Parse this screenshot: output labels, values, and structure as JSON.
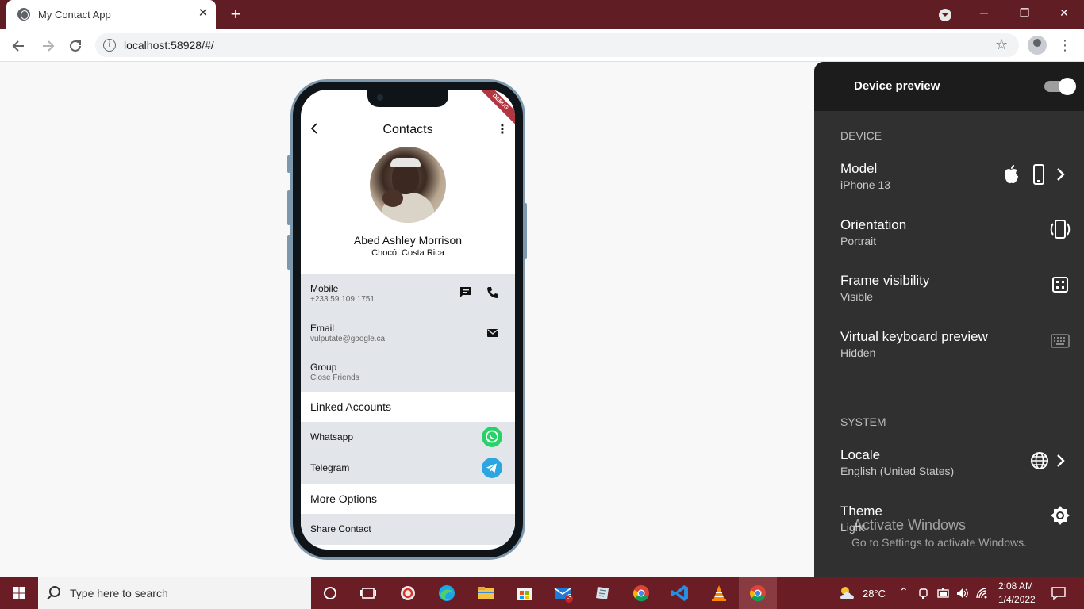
{
  "browser": {
    "tab_title": "My Contact App",
    "tab_close": "✕",
    "new_tab": "+",
    "url": "localhost:58928/#/",
    "window_controls": {
      "minimize": "─",
      "restore": "❐",
      "close": "✕"
    }
  },
  "app": {
    "title": "Contacts",
    "debug_banner": "DEBUG",
    "contact": {
      "name": "Abed Ashley Morrison",
      "location": "Chocó, Costa Rica"
    },
    "info": [
      {
        "label": "Mobile",
        "value": "+233 59 109 1751"
      },
      {
        "label": "Email",
        "value": "vulputate@google.ca"
      },
      {
        "label": "Group",
        "value": "Close Friends"
      }
    ],
    "linked_accounts": {
      "heading": "Linked Accounts",
      "items": [
        {
          "label": "Whatsapp",
          "color": "#25d366"
        },
        {
          "label": "Telegram",
          "color": "#2aa6e0"
        }
      ]
    },
    "more_options": {
      "heading": "More Options",
      "items": [
        "Share Contact"
      ]
    }
  },
  "device_preview": {
    "title": "Device preview",
    "enabled": true,
    "device_section": "DEVICE",
    "options": [
      {
        "title": "Model",
        "value": "iPhone 13"
      },
      {
        "title": "Orientation",
        "value": "Portrait"
      },
      {
        "title": "Frame visibility",
        "value": "Visible"
      },
      {
        "title": "Virtual keyboard preview",
        "value": "Hidden"
      }
    ],
    "system_section": "SYSTEM",
    "system_options": [
      {
        "title": "Locale",
        "value": "English (United States)"
      },
      {
        "title": "Theme",
        "value": "Light"
      }
    ]
  },
  "watermark": {
    "line1": "Activate Windows",
    "line2": "Go to Settings to activate Windows."
  },
  "taskbar": {
    "search_placeholder": "Type here to search",
    "mail_badge": "3",
    "weather": "28°C",
    "time": "2:08 AM",
    "date": "1/4/2022"
  },
  "colors": {
    "title_bar": "#601d23",
    "taskbar": "#6a1d24",
    "panel": "#303030",
    "row_bg": "#e2e5e9"
  }
}
